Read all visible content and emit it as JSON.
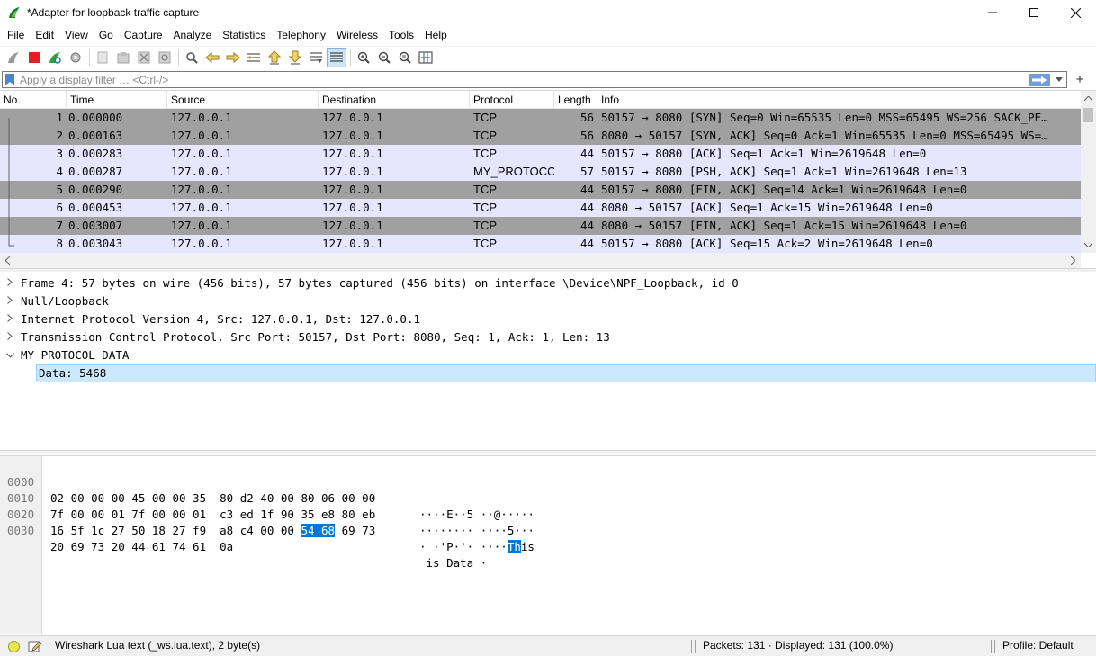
{
  "window": {
    "title": "*Adapter for loopback traffic capture",
    "minimize": "—",
    "maximize": "☐",
    "close": "✕"
  },
  "menu": [
    "File",
    "Edit",
    "View",
    "Go",
    "Capture",
    "Analyze",
    "Statistics",
    "Telephony",
    "Wireless",
    "Tools",
    "Help"
  ],
  "filter": {
    "placeholder": "Apply a display filter … <Ctrl-/>",
    "plus": "+"
  },
  "packet_list": {
    "columns": [
      "No.",
      "Time",
      "Source",
      "Destination",
      "Protocol",
      "Length",
      "Info"
    ],
    "rows": [
      {
        "no": "1",
        "time": "0.000000",
        "source": "127.0.0.1",
        "destination": "127.0.0.1",
        "protocol": "TCP",
        "length": "56",
        "info": "50157 → 8080 [SYN] Seq=0 Win=65535 Len=0 MSS=65495 WS=256 SACK_PE…",
        "style": "gray"
      },
      {
        "no": "2",
        "time": "0.000163",
        "source": "127.0.0.1",
        "destination": "127.0.0.1",
        "protocol": "TCP",
        "length": "56",
        "info": "8080 → 50157 [SYN, ACK] Seq=0 Ack=1 Win=65535 Len=0 MSS=65495 WS=…",
        "style": "gray"
      },
      {
        "no": "3",
        "time": "0.000283",
        "source": "127.0.0.1",
        "destination": "127.0.0.1",
        "protocol": "TCP",
        "length": "44",
        "info": "50157 → 8080 [ACK] Seq=1 Ack=1 Win=2619648 Len=0",
        "style": "light"
      },
      {
        "no": "4",
        "time": "0.000287",
        "source": "127.0.0.1",
        "destination": "127.0.0.1",
        "protocol": "MY_PROTOCOL",
        "length": "57",
        "info": "50157 → 8080 [PSH, ACK] Seq=1 Ack=1 Win=2619648 Len=13",
        "style": "light"
      },
      {
        "no": "5",
        "time": "0.000290",
        "source": "127.0.0.1",
        "destination": "127.0.0.1",
        "protocol": "TCP",
        "length": "44",
        "info": "50157 → 8080 [FIN, ACK] Seq=14 Ack=1 Win=2619648 Len=0",
        "style": "gray"
      },
      {
        "no": "6",
        "time": "0.000453",
        "source": "127.0.0.1",
        "destination": "127.0.0.1",
        "protocol": "TCP",
        "length": "44",
        "info": "8080 → 50157 [ACK] Seq=1 Ack=15 Win=2619648 Len=0",
        "style": "light"
      },
      {
        "no": "7",
        "time": "0.003007",
        "source": "127.0.0.1",
        "destination": "127.0.0.1",
        "protocol": "TCP",
        "length": "44",
        "info": "8080 → 50157 [FIN, ACK] Seq=1 Ack=15 Win=2619648 Len=0",
        "style": "gray"
      },
      {
        "no": "8",
        "time": "0.003043",
        "source": "127.0.0.1",
        "destination": "127.0.0.1",
        "protocol": "TCP",
        "length": "44",
        "info": "50157 → 8080 [ACK] Seq=15 Ack=2 Win=2619648 Len=0",
        "style": "light"
      }
    ]
  },
  "details": {
    "items": [
      {
        "text": "Frame 4: 57 bytes on wire (456 bits), 57 bytes captured (456 bits) on interface \\Device\\NPF_Loopback, id 0",
        "expanded": false
      },
      {
        "text": "Null/Loopback",
        "expanded": false
      },
      {
        "text": "Internet Protocol Version 4, Src: 127.0.0.1, Dst: 127.0.0.1",
        "expanded": false
      },
      {
        "text": "Transmission Control Protocol, Src Port: 50157, Dst Port: 8080, Seq: 1, Ack: 1, Len: 13",
        "expanded": false
      },
      {
        "text": "MY PROTOCOL DATA",
        "expanded": true
      }
    ],
    "selected_child": "Data: 5468"
  },
  "bytes": {
    "lines": [
      {
        "offset": "0000",
        "hex_pre": "02 00 00 00 45 00 00 35  80 d2 40 00 80 06 00 00",
        "hex_hl": "",
        "hex_post": "",
        "ascii_pre": "····E··5 ··@·····",
        "ascii_hl": "",
        "ascii_post": ""
      },
      {
        "offset": "0010",
        "hex_pre": "7f 00 00 01 7f 00 00 01  c3 ed 1f 90 35 e8 80 eb",
        "hex_hl": "",
        "hex_post": "",
        "ascii_pre": "········ ····5···",
        "ascii_hl": "",
        "ascii_post": ""
      },
      {
        "offset": "0020",
        "hex_pre": "16 5f 1c 27 50 18 27 f9  a8 c4 00 00 ",
        "hex_hl": "54 68",
        "hex_post": " 69 73",
        "ascii_pre": "·_·'P·'· ····",
        "ascii_hl": "Th",
        "ascii_post": "is"
      },
      {
        "offset": "0030",
        "hex_pre": "20 69 73 20 44 61 74 61  0a",
        "hex_hl": "",
        "hex_post": "",
        "ascii_pre": " is Data ·",
        "ascii_hl": "",
        "ascii_post": ""
      }
    ]
  },
  "status": {
    "field": "Wireshark Lua text (_ws.lua.text), 2 byte(s)",
    "packets": "Packets: 131 · Displayed: 131 (100.0%)",
    "profile": "Profile: Default"
  },
  "colors": {
    "row_gray": "#a0a0a0",
    "row_light": "#e7e6ff",
    "selection": "#cce8ff",
    "byte_highlight": "#0078d7"
  }
}
